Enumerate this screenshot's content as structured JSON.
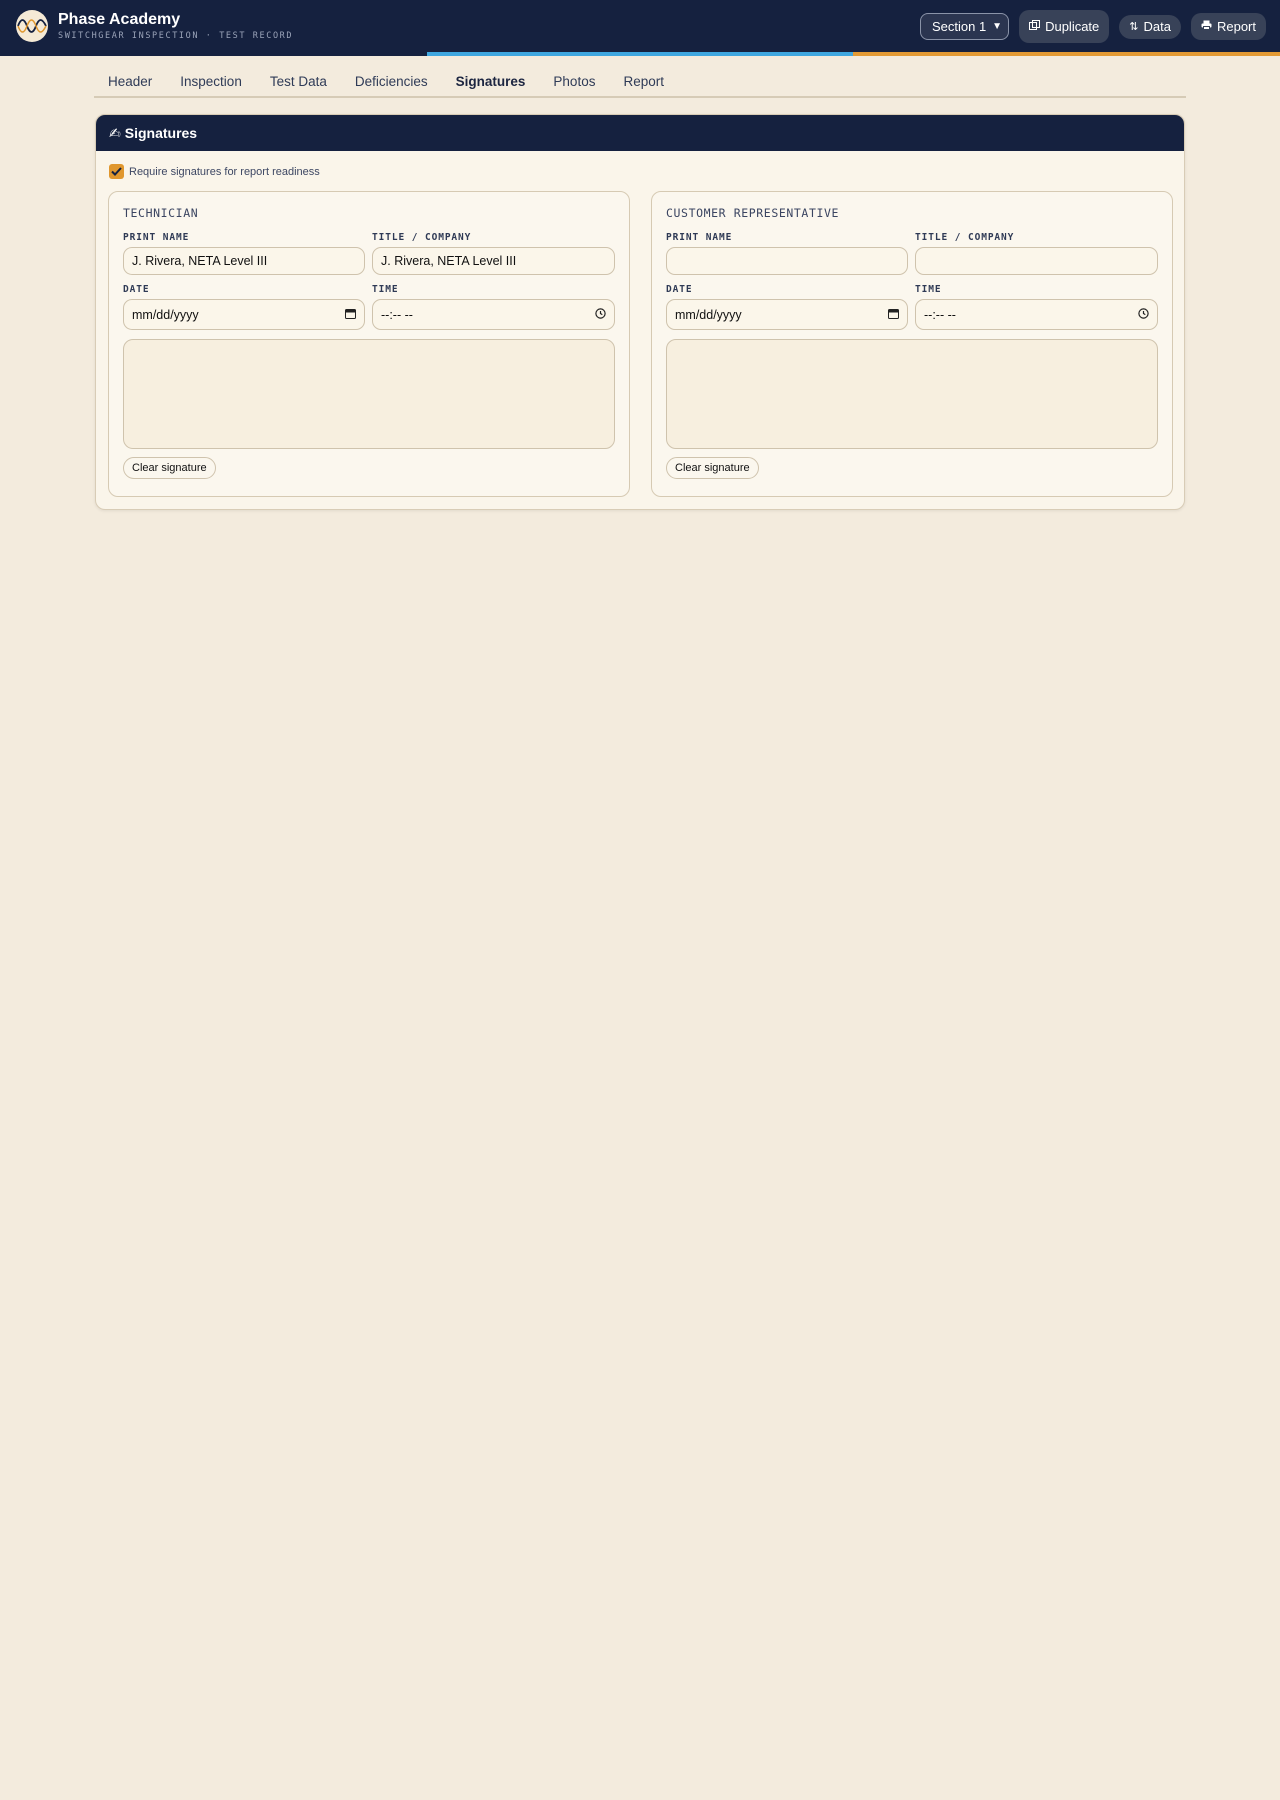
{
  "app": {
    "title": "Phase Academy",
    "subtitle": "SWITCHGEAR INSPECTION · TEST RECORD"
  },
  "toolbar": {
    "section_select": "Section 1",
    "duplicate_label": "Duplicate",
    "duplicate_icon": "copy-icon",
    "data_label": "Data",
    "data_icon": "⇅",
    "report_label": "Report",
    "report_icon": "printer-icon"
  },
  "tabs": [
    {
      "label": "Header",
      "active": false
    },
    {
      "label": "Inspection",
      "active": false
    },
    {
      "label": "Test Data",
      "active": false
    },
    {
      "label": "Deficiencies",
      "active": false
    },
    {
      "label": "Signatures",
      "active": true
    },
    {
      "label": "Photos",
      "active": false
    },
    {
      "label": "Report",
      "active": false
    }
  ],
  "card": {
    "title": "Signatures",
    "title_icon": "✍",
    "require_label": "Require signatures for report readiness",
    "require_checked": true
  },
  "technician": {
    "title": "TECHNICIAN",
    "print_name_label": "PRINT NAME",
    "print_name_value": "J. Rivera, NETA Level III",
    "title_company_label": "TITLE / COMPANY",
    "title_company_value": "J. Rivera, NETA Level III",
    "date_label": "DATE",
    "date_placeholder": "mm/dd/yyyy",
    "time_label": "TIME",
    "time_placeholder": "--:-- --",
    "clear_label": "Clear signature"
  },
  "customer": {
    "title": "CUSTOMER REPRESENTATIVE",
    "print_name_label": "PRINT NAME",
    "print_name_value": "",
    "title_company_label": "TITLE / COMPANY",
    "title_company_value": "",
    "date_label": "DATE",
    "date_placeholder": "mm/dd/yyyy",
    "time_label": "TIME",
    "time_placeholder": "--:-- --",
    "clear_label": "Clear signature"
  },
  "colors": {
    "navy": "#15213f",
    "accent_orange": "#e0972e",
    "accent_blue": "#3fa7e0",
    "background": "#f3ebdd"
  }
}
